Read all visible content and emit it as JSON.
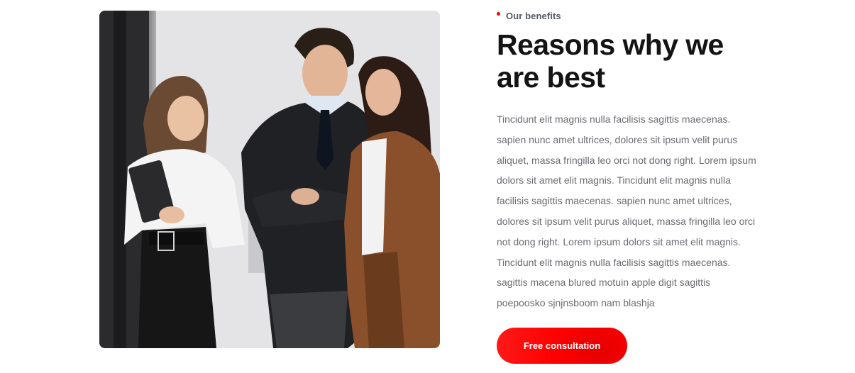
{
  "benefits": {
    "eyebrow": "Our benefits",
    "heading_line1": "Reasons why we",
    "heading_line2": "are best",
    "body": "Tincidunt elit magnis nulla facilisis sagittis maecenas. sapien nunc amet ultrices, dolores sit ipsum velit purus aliquet, massa fringilla leo orci not dong right. Lorem ipsum dolors sit amet elit magnis. Tincidunt elit magnis nulla facilisis sagittis maecenas. sapien nunc amet ultrices, dolores sit ipsum velit purus aliquet, massa fringilla leo orci not dong right. Lorem ipsum dolors sit amet elit magnis. Tincidunt elit magnis nulla facilisis sagittis maecenas. sagittis macena blured motuin apple digit sagittis poepoosko sjnjnsboom nam blashja",
    "cta_label": "Free consultation"
  },
  "colors": {
    "accent": "#ff0000",
    "heading": "#141414",
    "body": "#6b6b72"
  }
}
